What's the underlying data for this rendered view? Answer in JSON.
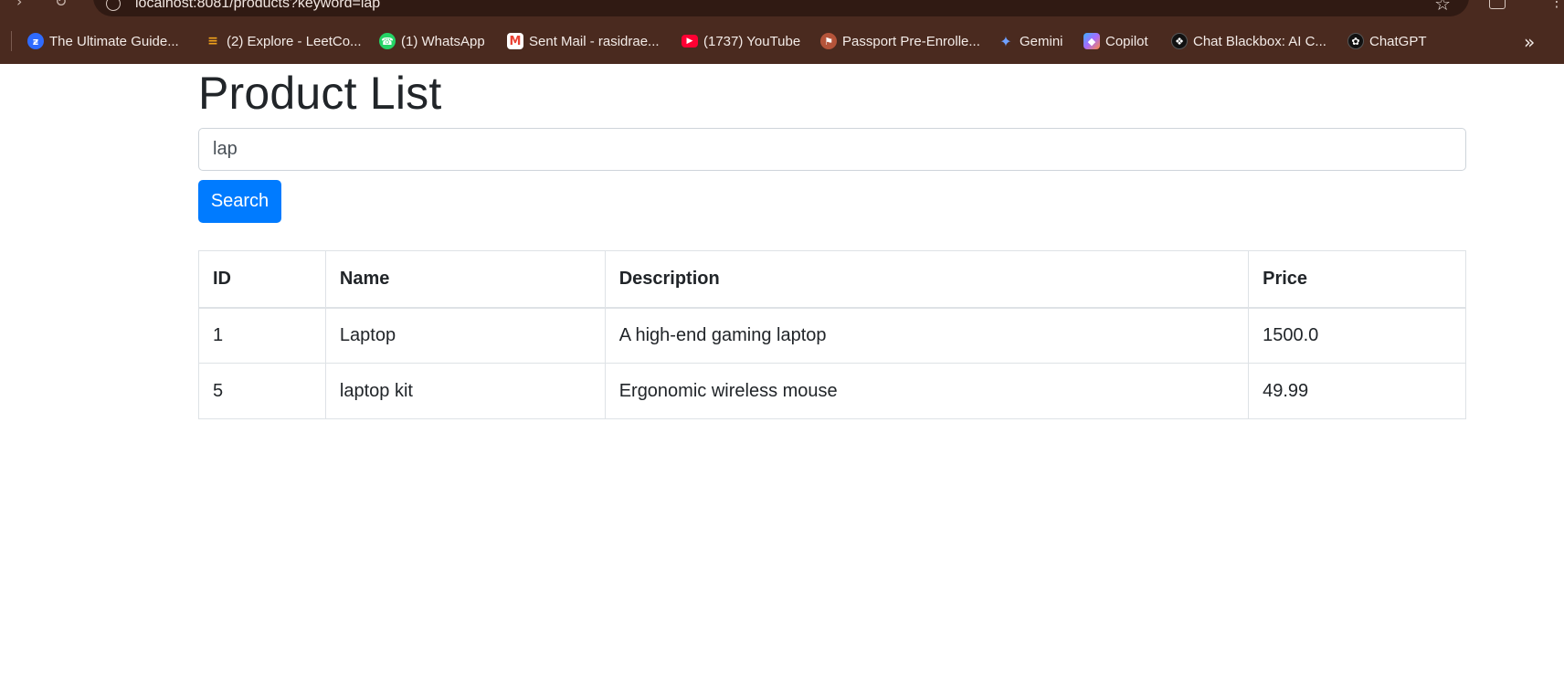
{
  "browser": {
    "url": "localhost:8081/products?keyword=lap",
    "bookmarks": [
      {
        "label": "The Ultimate Guide...",
        "icon": "kotlin-favicon-icon",
        "color": "#2f6bff",
        "glyph": "ƶ"
      },
      {
        "label": "(2) Explore - LeetCo...",
        "icon": "leetcode-favicon-icon",
        "color": "#1a1a1a",
        "glyph": "≡"
      },
      {
        "label": "(1) WhatsApp",
        "icon": "whatsapp-favicon-icon",
        "color": "#25d366",
        "glyph": "☎"
      },
      {
        "label": "Sent Mail - rasidrae...",
        "icon": "gmail-favicon-icon",
        "color": "#ea4335",
        "glyph": "M"
      },
      {
        "label": "(1737) YouTube",
        "icon": "youtube-favicon-icon",
        "color": "#ff0033",
        "glyph": "▶"
      },
      {
        "label": "Passport Pre-Enrolle...",
        "icon": "passport-favicon-icon",
        "color": "#b5543a",
        "glyph": "⚑"
      },
      {
        "label": "Gemini",
        "icon": "gemini-favicon-icon",
        "color": "#4a7bf0",
        "glyph": "✦"
      },
      {
        "label": "Copilot",
        "icon": "copilot-favicon-icon",
        "color": "#8b6cf0",
        "glyph": "◆"
      },
      {
        "label": "Chat Blackbox: AI C...",
        "icon": "blackbox-favicon-icon",
        "color": "#111111",
        "glyph": "❖"
      },
      {
        "label": "ChatGPT",
        "icon": "chatgpt-favicon-icon",
        "color": "#111111",
        "glyph": "✿"
      }
    ],
    "more_glyph": "»"
  },
  "page": {
    "title": "Product List",
    "search": {
      "value": "lap",
      "button_label": "Search"
    },
    "table": {
      "headers": {
        "id": "ID",
        "name": "Name",
        "description": "Description",
        "price": "Price"
      },
      "rows": [
        {
          "id": "1",
          "name": "Laptop",
          "description": "A high-end gaming laptop",
          "price": "1500.0"
        },
        {
          "id": "5",
          "name": "laptop kit",
          "description": "Ergonomic wireless mouse",
          "price": "49.99"
        }
      ]
    }
  },
  "colors": {
    "chrome": "#4a2a1f",
    "accent": "#007bff",
    "text": "#212529"
  }
}
